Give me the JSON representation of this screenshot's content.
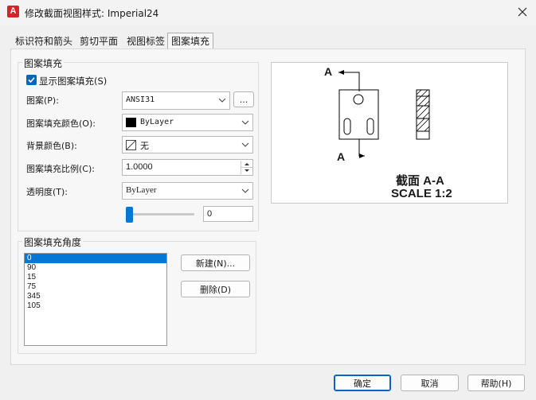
{
  "window": {
    "title": "修改截面视图样式: Imperial24",
    "app_icon": "A"
  },
  "tabs": [
    {
      "label": "标识符和箭头"
    },
    {
      "label": "剪切平面"
    },
    {
      "label": "视图标签"
    },
    {
      "label": "图案填充"
    }
  ],
  "hatch_group": {
    "title": "图案填充",
    "show_hatch": {
      "label": "显示图案填充(S)",
      "checked": true
    },
    "pattern": {
      "label": "图案(P):",
      "value": "ANSI31",
      "browse_label": "..."
    },
    "hatch_color": {
      "label": "图案填充颜色(O):",
      "value": "ByLayer",
      "swatch_color": "#000000"
    },
    "bg_color": {
      "label": "背景颜色(B):",
      "value": "无"
    },
    "hatch_scale": {
      "label": "图案填充比例(C):",
      "value": "1.0000"
    },
    "transparency": {
      "label": "透明度(T):",
      "value": "ByLayer",
      "slider_value": "0"
    }
  },
  "angle_group": {
    "title": "图案填充角度",
    "angles": [
      "0",
      "90",
      "15",
      "75",
      "345",
      "105"
    ],
    "selected_index": 0,
    "new_button": "新建(N)...",
    "delete_button": "删除(D)"
  },
  "preview": {
    "label_top": "A",
    "label_bottom": "A",
    "section_title": "截面 A-A",
    "scale_text": "SCALE 1:2"
  },
  "footer": {
    "ok": "确定",
    "cancel": "取消",
    "help": "帮助(H)"
  },
  "colors": {
    "accent": "#0078d7",
    "app_icon": "#d6232a"
  }
}
